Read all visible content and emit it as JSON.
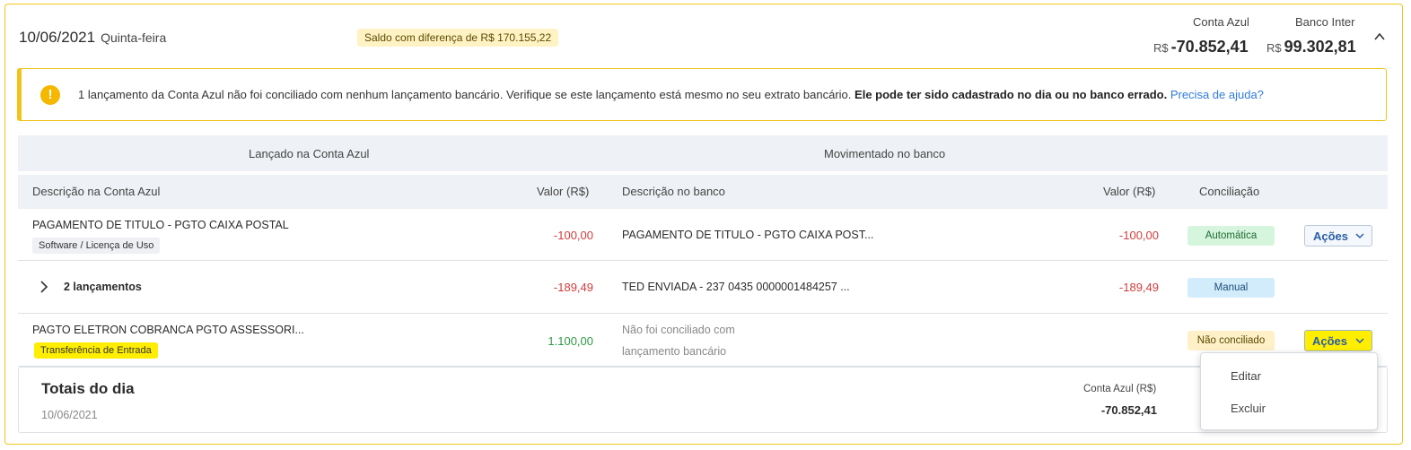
{
  "header": {
    "date": "10/06/2021",
    "weekday": "Quinta-feira",
    "badge": "Saldo com diferença de R$ 170.155,22",
    "accounts": [
      {
        "label": "Conta Azul",
        "currency": "R$",
        "value": "-70.852,41"
      },
      {
        "label": "Banco Inter",
        "currency": "R$",
        "value": "99.302,81"
      }
    ]
  },
  "alert": {
    "text": "1 lançamento da Conta Azul não foi conciliado com nenhum lançamento bancário. Verifique se este lançamento está mesmo no seu extrato bancário.",
    "bold": "Ele pode ter sido cadastrado no dia ou no banco errado.",
    "link": "Precisa de ajuda?"
  },
  "table": {
    "group_left": "Lançado na Conta Azul",
    "group_right": "Movimentado no banco",
    "columns": {
      "desc_ca": "Descrição na Conta Azul",
      "val_ca": "Valor (R$)",
      "desc_bank": "Descrição no banco",
      "val_bank": "Valor (R$)",
      "reconciliation": "Conciliação"
    },
    "rows": [
      {
        "desc": "PAGAMENTO DE TITULO - PGTO CAIXA POSTAL",
        "category": "Software / Licença de Uso",
        "value": "-100,00",
        "bank_desc": "PAGAMENTO DE TITULO - PGTO CAIXA POST...",
        "bank_value": "-100,00",
        "status": "Automática",
        "action": "Ações"
      },
      {
        "desc": "2 lançamentos",
        "value": "-189,49",
        "bank_desc": "TED ENVIADA - 237 0435 0000001484257 ...",
        "bank_value": "-189,49",
        "status": "Manual"
      },
      {
        "desc": "PAGTO ELETRON COBRANCA PGTO ASSESSORI...",
        "category": "Transferência de Entrada",
        "value": "1.100,00",
        "bank_desc_line1": "Não foi conciliado com",
        "bank_desc_line2": "lançamento bancário",
        "status": "Não conciliado",
        "action": "Ações"
      }
    ]
  },
  "totals": {
    "title": "Totais do dia",
    "date": "10/06/2021",
    "label": "Conta Azul (R$)",
    "value": "-70.852,41"
  },
  "dropdown": {
    "items": [
      "Editar",
      "Excluir"
    ]
  },
  "colors": {
    "accent": "#f0c419",
    "negative": "#d43b3b",
    "positive": "#2e9a47",
    "link": "#2f7bd9",
    "highlight": "#ffee00"
  }
}
